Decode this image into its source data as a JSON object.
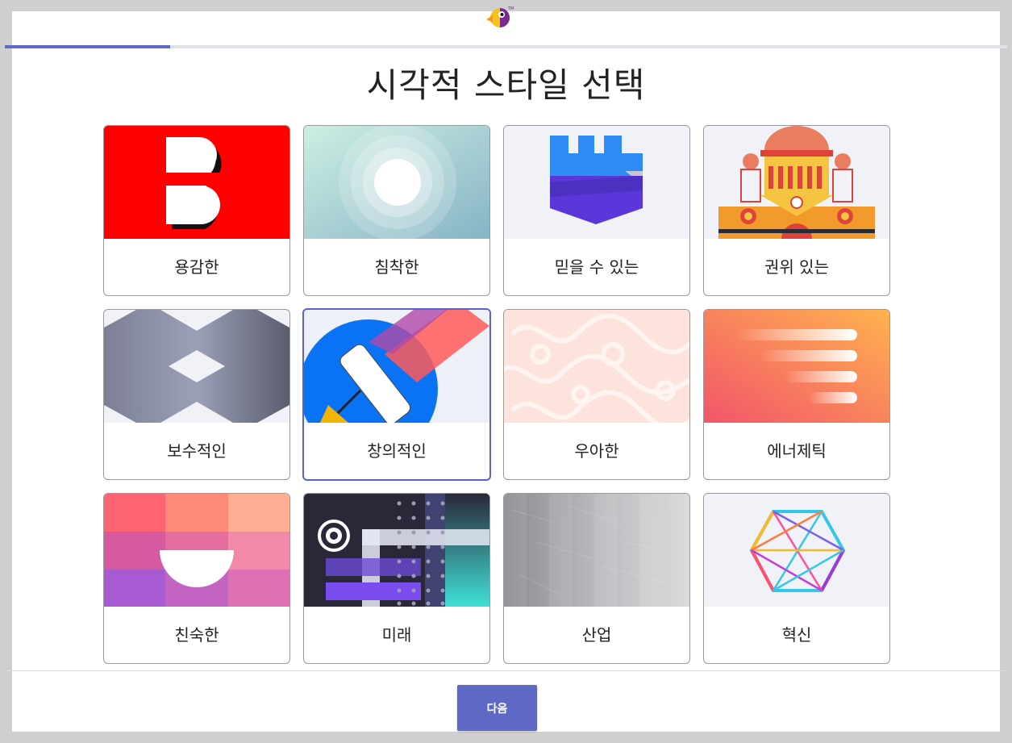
{
  "header": {
    "logo_icon": "parrot-logo-icon",
    "progress_fraction": 0.165
  },
  "page": {
    "title": "시각적 스타일 선택"
  },
  "styles": [
    {
      "label": "용감한",
      "icon": "bold-b-icon"
    },
    {
      "label": "침착한",
      "icon": "calm-circles-icon"
    },
    {
      "label": "믿을 수 있는",
      "icon": "castle-tower-icon"
    },
    {
      "label": "권위 있는",
      "icon": "palace-building-icon"
    },
    {
      "label": "보수적인",
      "icon": "isometric-blocks-icon"
    },
    {
      "label": "창의적인",
      "icon": "paint-roller-icon",
      "selected": true
    },
    {
      "label": "우아한",
      "icon": "floral-pattern-icon"
    },
    {
      "label": "에너제틱",
      "icon": "speed-lines-icon"
    },
    {
      "label": "친숙한",
      "icon": "smile-grid-icon"
    },
    {
      "label": "미래",
      "icon": "futuristic-dots-icon"
    },
    {
      "label": "산업",
      "icon": "brushed-metal-icon"
    },
    {
      "label": "혁신",
      "icon": "hexagon-network-icon"
    }
  ],
  "footer": {
    "next_label": "다음"
  },
  "colors": {
    "accent": "#5e69c6",
    "selected_border": "#5763c9"
  }
}
